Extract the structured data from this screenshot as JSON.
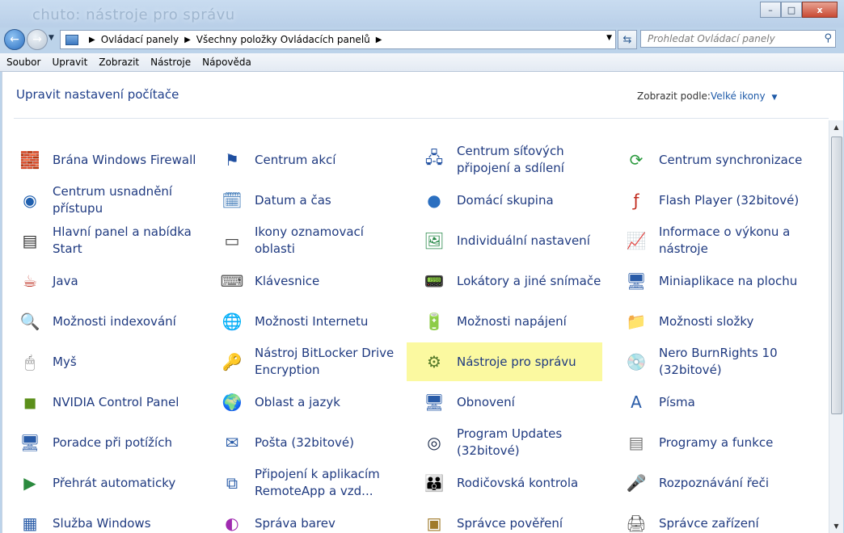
{
  "window": {
    "ghost_title": "chuto: nástroje pro správu",
    "minimize": "–",
    "maximize": "□",
    "close": "x"
  },
  "nav": {
    "back_glyph": "←",
    "forward_glyph": "→",
    "breadcrumb": [
      "Ovládací panely",
      "Všechny položky Ovládacích panelů"
    ],
    "search_placeholder": "Prohledat Ovládací panely"
  },
  "menu": [
    "Soubor",
    "Upravit",
    "Zobrazit",
    "Nástroje",
    "Nápověda"
  ],
  "header": {
    "title": "Upravit nastavení počítače",
    "view_by_label": "Zobrazit podle:",
    "view_by_value": "Velké ikony"
  },
  "items": [
    [
      {
        "label": "Brána Windows Firewall",
        "icon": "firewall-icon",
        "glyph": "🧱",
        "color": "#b14a2a"
      },
      {
        "label": "Centrum usnadnění přístupu",
        "icon": "ease-of-access-icon",
        "glyph": "◉",
        "color": "#1f5fae"
      },
      {
        "label": "Hlavní panel a nabídka Start",
        "icon": "taskbar-icon",
        "glyph": "▤",
        "color": "#333"
      },
      {
        "label": "Java",
        "icon": "java-icon",
        "glyph": "☕",
        "color": "#c0392b"
      },
      {
        "label": "Možnosti indexování",
        "icon": "indexing-icon",
        "glyph": "🔍",
        "color": "#666"
      },
      {
        "label": "Myš",
        "icon": "mouse-icon",
        "glyph": "🖱",
        "color": "#777"
      },
      {
        "label": "NVIDIA Control Panel",
        "icon": "nvidia-icon",
        "glyph": "◼",
        "color": "#5b8f1a"
      },
      {
        "label": "Poradce při potížích",
        "icon": "troubleshoot-icon",
        "glyph": "🖥",
        "color": "#2a5ca8"
      },
      {
        "label": "Přehrát automaticky",
        "icon": "autoplay-icon",
        "glyph": "▶",
        "color": "#2b8a3e"
      },
      {
        "label": "Služba Windows",
        "icon": "windows-service-icon",
        "glyph": "▦",
        "color": "#2a5ca8"
      }
    ],
    [
      {
        "label": "Centrum akcí",
        "icon": "action-center-icon",
        "glyph": "⚑",
        "color": "#1f4fa0"
      },
      {
        "label": "Datum a čas",
        "icon": "date-time-icon",
        "glyph": "🗓",
        "color": "#2a6bb0"
      },
      {
        "label": "Ikony oznamovací oblasti",
        "icon": "notification-icons-icon",
        "glyph": "▭",
        "color": "#444"
      },
      {
        "label": "Klávesnice",
        "icon": "keyboard-icon",
        "glyph": "⌨",
        "color": "#555"
      },
      {
        "label": "Možnosti Internetu",
        "icon": "internet-options-icon",
        "glyph": "🌐",
        "color": "#1f6fb0"
      },
      {
        "label": "Nástroj BitLocker Drive Encryption",
        "icon": "bitlocker-icon",
        "glyph": "🔑",
        "color": "#a07a2a"
      },
      {
        "label": "Oblast a jazyk",
        "icon": "region-language-icon",
        "glyph": "🌍",
        "color": "#2b8a3e"
      },
      {
        "label": "Pošta (32bitové)",
        "icon": "mail-icon",
        "glyph": "✉",
        "color": "#2a5ca8"
      },
      {
        "label": "Připojení k aplikacím RemoteApp a vzd...",
        "icon": "remoteapp-icon",
        "glyph": "⧉",
        "color": "#2a5ca8"
      },
      {
        "label": "Správa barev",
        "icon": "color-management-icon",
        "glyph": "◐",
        "color": "#a02ab0"
      }
    ],
    [
      {
        "label": "Centrum síťových připojení a sdílení",
        "icon": "network-center-icon",
        "glyph": "🖧",
        "color": "#1f4fa0"
      },
      {
        "label": "Domácí skupina",
        "icon": "homegroup-icon",
        "glyph": "●",
        "color": "#2b6fc0"
      },
      {
        "label": "Individuální nastavení",
        "icon": "personalization-icon",
        "glyph": "🖼",
        "color": "#2a8a4a"
      },
      {
        "label": "Lokátory a jiné snímače",
        "icon": "location-sensors-icon",
        "glyph": "📟",
        "color": "#7a8a2a"
      },
      {
        "label": "Možnosti napájení",
        "icon": "power-options-icon",
        "glyph": "🔋",
        "color": "#2b8a3e"
      },
      {
        "label": "Nástroje pro správu",
        "icon": "admin-tools-icon",
        "glyph": "⚙",
        "color": "#557a2a"
      },
      {
        "label": "Obnovení",
        "icon": "recovery-icon",
        "glyph": "🖥",
        "color": "#2a5ca8"
      },
      {
        "label": "Program Updates (32bitové)",
        "icon": "program-updates-icon",
        "glyph": "◎",
        "color": "#1a2a4a"
      },
      {
        "label": "Rodičovská kontrola",
        "icon": "parental-controls-icon",
        "glyph": "👪",
        "color": "#c07a1a"
      },
      {
        "label": "Správce pověření",
        "icon": "credential-manager-icon",
        "glyph": "▣",
        "color": "#a07a2a"
      }
    ],
    [
      {
        "label": "Centrum synchronizace",
        "icon": "sync-center-icon",
        "glyph": "⟳",
        "color": "#2b9a3e"
      },
      {
        "label": "Flash Player (32bitové)",
        "icon": "flash-icon",
        "glyph": "ƒ",
        "color": "#c0281a"
      },
      {
        "label": "Informace o výkonu a nástroje",
        "icon": "performance-icon",
        "glyph": "📈",
        "color": "#2b8a3e"
      },
      {
        "label": "Miniaplikace na plochu",
        "icon": "gadgets-icon",
        "glyph": "🖥",
        "color": "#2a5ca8"
      },
      {
        "label": "Možnosti složky",
        "icon": "folder-options-icon",
        "glyph": "📁",
        "color": "#c9a22a"
      },
      {
        "label": "Nero BurnRights 10 (32bitové)",
        "icon": "nero-icon",
        "glyph": "💿",
        "color": "#888"
      },
      {
        "label": "Písma",
        "icon": "fonts-icon",
        "glyph": "A",
        "color": "#2a5ca8"
      },
      {
        "label": "Programy a funkce",
        "icon": "programs-features-icon",
        "glyph": "▤",
        "color": "#777"
      },
      {
        "label": "Rozpoznávání řeči",
        "icon": "speech-recognition-icon",
        "glyph": "🎤",
        "color": "#555"
      },
      {
        "label": "Správce zařízení",
        "icon": "device-manager-icon",
        "glyph": "🖨",
        "color": "#555"
      }
    ]
  ]
}
